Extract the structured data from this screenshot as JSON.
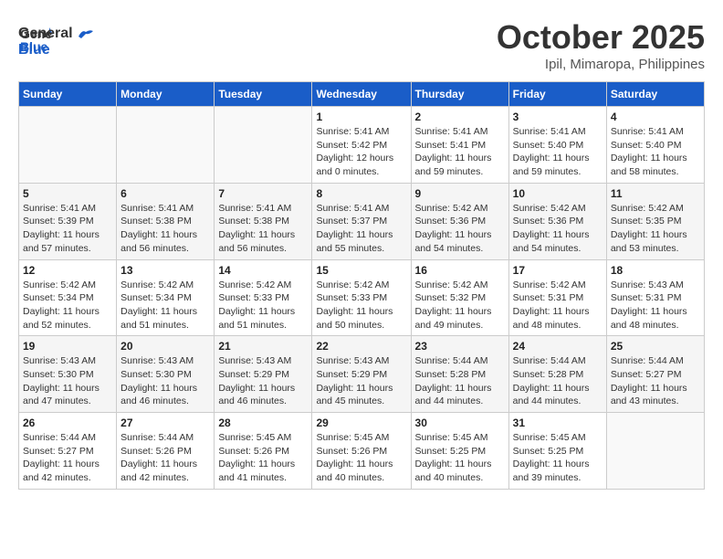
{
  "header": {
    "logo_general": "General",
    "logo_blue": "Blue",
    "month": "October 2025",
    "location": "Ipil, Mimaropa, Philippines"
  },
  "weekdays": [
    "Sunday",
    "Monday",
    "Tuesday",
    "Wednesday",
    "Thursday",
    "Friday",
    "Saturday"
  ],
  "weeks": [
    [
      {
        "day": "",
        "info": ""
      },
      {
        "day": "",
        "info": ""
      },
      {
        "day": "",
        "info": ""
      },
      {
        "day": "1",
        "info": "Sunrise: 5:41 AM\nSunset: 5:42 PM\nDaylight: 12 hours\nand 0 minutes."
      },
      {
        "day": "2",
        "info": "Sunrise: 5:41 AM\nSunset: 5:41 PM\nDaylight: 11 hours\nand 59 minutes."
      },
      {
        "day": "3",
        "info": "Sunrise: 5:41 AM\nSunset: 5:40 PM\nDaylight: 11 hours\nand 59 minutes."
      },
      {
        "day": "4",
        "info": "Sunrise: 5:41 AM\nSunset: 5:40 PM\nDaylight: 11 hours\nand 58 minutes."
      }
    ],
    [
      {
        "day": "5",
        "info": "Sunrise: 5:41 AM\nSunset: 5:39 PM\nDaylight: 11 hours\nand 57 minutes."
      },
      {
        "day": "6",
        "info": "Sunrise: 5:41 AM\nSunset: 5:38 PM\nDaylight: 11 hours\nand 56 minutes."
      },
      {
        "day": "7",
        "info": "Sunrise: 5:41 AM\nSunset: 5:38 PM\nDaylight: 11 hours\nand 56 minutes."
      },
      {
        "day": "8",
        "info": "Sunrise: 5:41 AM\nSunset: 5:37 PM\nDaylight: 11 hours\nand 55 minutes."
      },
      {
        "day": "9",
        "info": "Sunrise: 5:42 AM\nSunset: 5:36 PM\nDaylight: 11 hours\nand 54 minutes."
      },
      {
        "day": "10",
        "info": "Sunrise: 5:42 AM\nSunset: 5:36 PM\nDaylight: 11 hours\nand 54 minutes."
      },
      {
        "day": "11",
        "info": "Sunrise: 5:42 AM\nSunset: 5:35 PM\nDaylight: 11 hours\nand 53 minutes."
      }
    ],
    [
      {
        "day": "12",
        "info": "Sunrise: 5:42 AM\nSunset: 5:34 PM\nDaylight: 11 hours\nand 52 minutes."
      },
      {
        "day": "13",
        "info": "Sunrise: 5:42 AM\nSunset: 5:34 PM\nDaylight: 11 hours\nand 51 minutes."
      },
      {
        "day": "14",
        "info": "Sunrise: 5:42 AM\nSunset: 5:33 PM\nDaylight: 11 hours\nand 51 minutes."
      },
      {
        "day": "15",
        "info": "Sunrise: 5:42 AM\nSunset: 5:33 PM\nDaylight: 11 hours\nand 50 minutes."
      },
      {
        "day": "16",
        "info": "Sunrise: 5:42 AM\nSunset: 5:32 PM\nDaylight: 11 hours\nand 49 minutes."
      },
      {
        "day": "17",
        "info": "Sunrise: 5:42 AM\nSunset: 5:31 PM\nDaylight: 11 hours\nand 48 minutes."
      },
      {
        "day": "18",
        "info": "Sunrise: 5:43 AM\nSunset: 5:31 PM\nDaylight: 11 hours\nand 48 minutes."
      }
    ],
    [
      {
        "day": "19",
        "info": "Sunrise: 5:43 AM\nSunset: 5:30 PM\nDaylight: 11 hours\nand 47 minutes."
      },
      {
        "day": "20",
        "info": "Sunrise: 5:43 AM\nSunset: 5:30 PM\nDaylight: 11 hours\nand 46 minutes."
      },
      {
        "day": "21",
        "info": "Sunrise: 5:43 AM\nSunset: 5:29 PM\nDaylight: 11 hours\nand 46 minutes."
      },
      {
        "day": "22",
        "info": "Sunrise: 5:43 AM\nSunset: 5:29 PM\nDaylight: 11 hours\nand 45 minutes."
      },
      {
        "day": "23",
        "info": "Sunrise: 5:44 AM\nSunset: 5:28 PM\nDaylight: 11 hours\nand 44 minutes."
      },
      {
        "day": "24",
        "info": "Sunrise: 5:44 AM\nSunset: 5:28 PM\nDaylight: 11 hours\nand 44 minutes."
      },
      {
        "day": "25",
        "info": "Sunrise: 5:44 AM\nSunset: 5:27 PM\nDaylight: 11 hours\nand 43 minutes."
      }
    ],
    [
      {
        "day": "26",
        "info": "Sunrise: 5:44 AM\nSunset: 5:27 PM\nDaylight: 11 hours\nand 42 minutes."
      },
      {
        "day": "27",
        "info": "Sunrise: 5:44 AM\nSunset: 5:26 PM\nDaylight: 11 hours\nand 42 minutes."
      },
      {
        "day": "28",
        "info": "Sunrise: 5:45 AM\nSunset: 5:26 PM\nDaylight: 11 hours\nand 41 minutes."
      },
      {
        "day": "29",
        "info": "Sunrise: 5:45 AM\nSunset: 5:26 PM\nDaylight: 11 hours\nand 40 minutes."
      },
      {
        "day": "30",
        "info": "Sunrise: 5:45 AM\nSunset: 5:25 PM\nDaylight: 11 hours\nand 40 minutes."
      },
      {
        "day": "31",
        "info": "Sunrise: 5:45 AM\nSunset: 5:25 PM\nDaylight: 11 hours\nand 39 minutes."
      },
      {
        "day": "",
        "info": ""
      }
    ]
  ]
}
